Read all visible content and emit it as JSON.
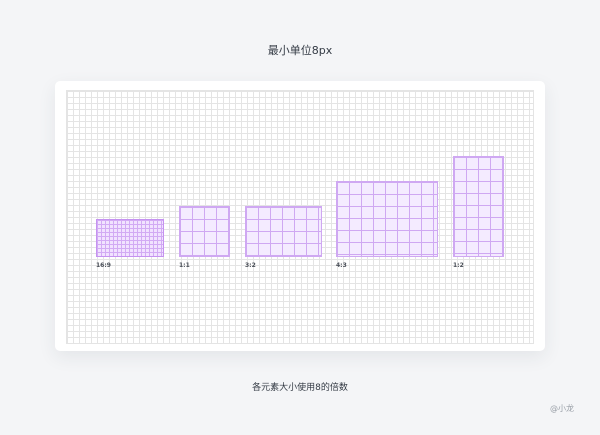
{
  "header": {
    "title": "最小单位8px"
  },
  "diagram": {
    "shapes": [
      {
        "label": "16:9"
      },
      {
        "label": "1:1"
      },
      {
        "label": "3:2"
      },
      {
        "label": "4:3"
      },
      {
        "label": "1:2"
      }
    ]
  },
  "footer": {
    "caption": "各元素大小使用8的倍数",
    "credit": "@小龙"
  },
  "colors": {
    "background": "#f4f5f7",
    "grid_line": "#e4e4e4",
    "shape_fill": "#f4ebff",
    "shape_border": "#cfa8f2"
  }
}
